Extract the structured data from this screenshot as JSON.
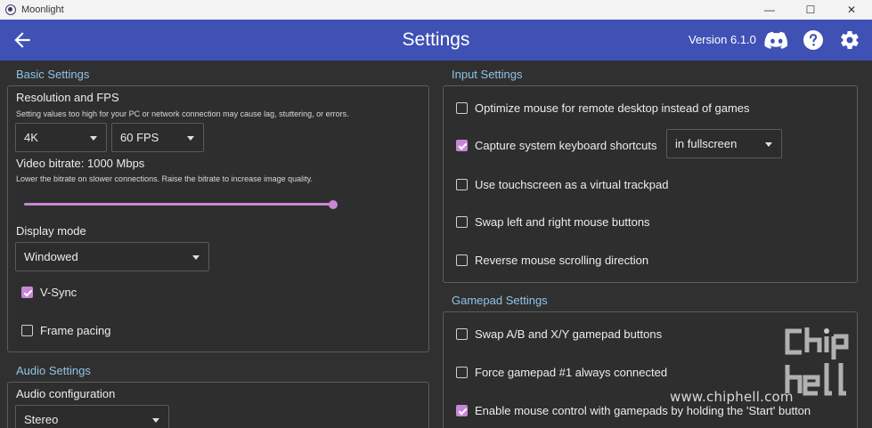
{
  "window": {
    "title": "Moonlight",
    "minimize_glyph": "—",
    "maximize_glyph": "☐",
    "close_glyph": "✕"
  },
  "toolbar": {
    "title": "Settings",
    "version": "Version 6.1.0",
    "icons": [
      "arrow-left-icon",
      "discord-icon",
      "help-icon",
      "gear-icon"
    ],
    "background": "#3f51b5"
  },
  "basic": {
    "header": "Basic Settings",
    "resolution_title": "Resolution and FPS",
    "resolution_hint": "Setting values too high for your PC or network connection may cause lag, stuttering, or errors.",
    "resolution_value": "4K",
    "fps_value": "60 FPS",
    "bitrate_title": "Video bitrate: 1000 Mbps",
    "bitrate_hint": "Lower the bitrate on slower connections. Raise the bitrate to increase image quality.",
    "bitrate_level": 1.0,
    "display_mode_title": "Display mode",
    "display_mode_value": "Windowed",
    "vsync_label": "V-Sync",
    "vsync_checked": true,
    "frame_pacing_label": "Frame pacing",
    "frame_pacing_checked": false
  },
  "audio": {
    "header": "Audio Settings",
    "config_title": "Audio configuration",
    "config_value": "Stereo"
  },
  "input": {
    "header": "Input Settings",
    "items": [
      {
        "label": "Optimize mouse for remote desktop instead of games",
        "checked": false
      },
      {
        "label": "Capture system keyboard shortcuts",
        "checked": true
      },
      {
        "label": "Use touchscreen as a virtual trackpad",
        "checked": false
      },
      {
        "label": "Swap left and right mouse buttons",
        "checked": false
      },
      {
        "label": "Reverse mouse scrolling direction",
        "checked": false
      }
    ],
    "capture_mode_value": "in fullscreen"
  },
  "gamepad": {
    "header": "Gamepad Settings",
    "items": [
      {
        "label": "Swap A/B and X/Y gamepad buttons",
        "checked": false
      },
      {
        "label": "Force gamepad #1 always connected",
        "checked": false
      },
      {
        "label": "Enable mouse control with gamepads by holding the 'Start' button",
        "checked": true
      }
    ]
  },
  "watermark": {
    "site": "www.chiphell.com",
    "logo_text": "chiphell"
  },
  "colors": {
    "accent": "#c887d6",
    "section_header": "#8fc4e8",
    "background": "#303030"
  }
}
